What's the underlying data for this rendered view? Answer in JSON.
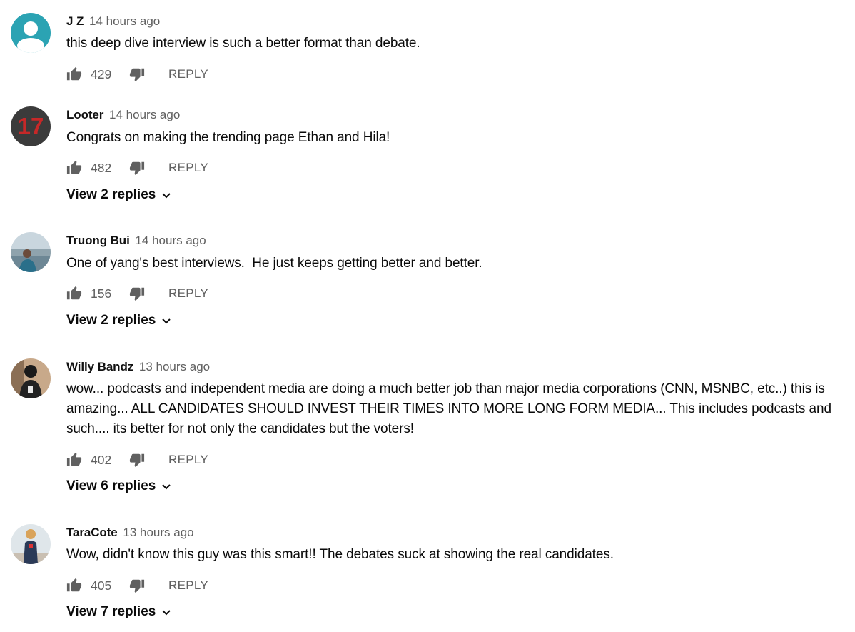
{
  "comments": [
    {
      "author": "J Z",
      "time": "14 hours ago",
      "text": "this deep dive interview is such a better format than debate.",
      "likes": "429",
      "reply_label": "REPLY",
      "replies": ""
    },
    {
      "author": "Looter",
      "time": "14 hours ago",
      "text": "Congrats on making the trending page Ethan and Hila!",
      "likes": "482",
      "reply_label": "REPLY",
      "replies": "View 2 replies",
      "avatar_text": "17"
    },
    {
      "author": "Truong Bui",
      "time": "14 hours ago",
      "text": "One of yang's best interviews.  He just keeps getting better and better.",
      "likes": "156",
      "reply_label": "REPLY",
      "replies": "View 2 replies"
    },
    {
      "author": "Willy Bandz",
      "time": "13 hours ago",
      "text": "wow... podcasts and independent media are doing a much better job than major media corporations (CNN, MSNBC, etc..) this is amazing... ALL CANDIDATES SHOULD INVEST THEIR TIMES INTO MORE LONG FORM MEDIA... This includes podcasts and such.... its better for not only the candidates but the voters!",
      "likes": "402",
      "reply_label": "REPLY",
      "replies": "View 6 replies"
    },
    {
      "author": "TaraCote",
      "time": "13 hours ago",
      "text": "Wow, didn't know this guy was this smart!! The debates suck at showing the real candidates.",
      "likes": "405",
      "reply_label": "REPLY",
      "replies": "View 7 replies"
    }
  ],
  "icons": {
    "like": "thumb-up-icon",
    "dislike": "thumb-down-icon",
    "expand": "chevron-down-icon"
  },
  "colors": {
    "meta_gray": "#606060",
    "avatar_teal": "#2ba3b3",
    "avatar_dark": "#3b3b3b",
    "avatar_17": "#c62828"
  }
}
